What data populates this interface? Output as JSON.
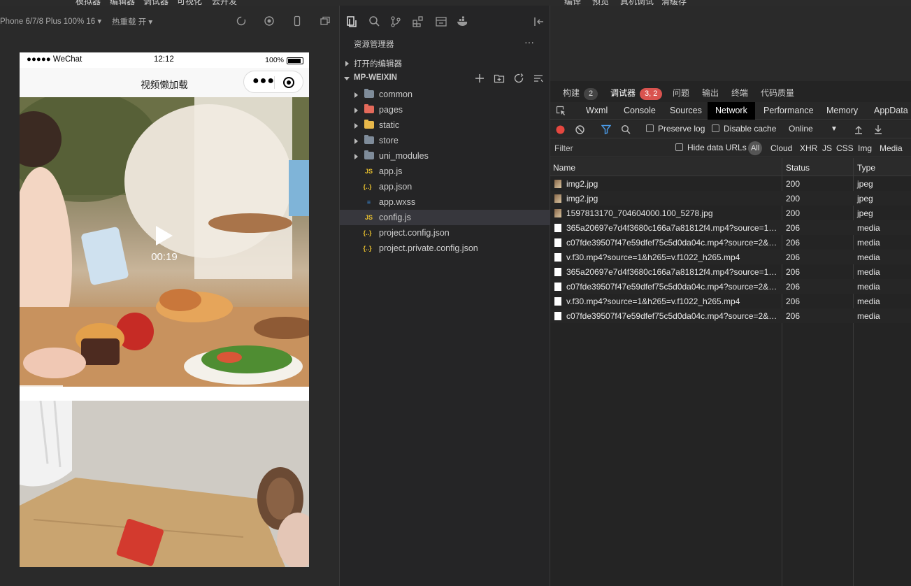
{
  "top_menu": {
    "left_items": [
      "模拟器",
      "编辑器",
      "调试器",
      "可视化",
      "云开发"
    ],
    "right_items": [
      "编译",
      "预览",
      "真机调试",
      "清缓存"
    ]
  },
  "simulator": {
    "device_label": "Phone 6/7/8 Plus 100% 16 ▾",
    "hot_reload_label": "热重载 开 ▾",
    "status_bar": {
      "carrier": "●●●●● WeChat",
      "time": "12:12",
      "battery": "100%"
    },
    "nav_title": "视频懒加载",
    "video1": {
      "duration": "00:19"
    }
  },
  "explorer": {
    "title": "资源管理器",
    "more": "···",
    "open_editors": "打开的编辑器",
    "root": "MP-WEIXIN",
    "folders": [
      {
        "name": "common",
        "color": "#7f8c9a"
      },
      {
        "name": "pages",
        "color": "#e46a5b"
      },
      {
        "name": "static",
        "color": "#e8b84a"
      },
      {
        "name": "store",
        "color": "#7f8c9a"
      },
      {
        "name": "uni_modules",
        "color": "#7f8c9a"
      }
    ],
    "files": [
      {
        "name": "app.js",
        "icon": "JS",
        "icon_color": "#e8c02e"
      },
      {
        "name": "app.json",
        "icon": "{..}",
        "icon_color": "#e8c02e"
      },
      {
        "name": "app.wxss",
        "icon": "≡",
        "icon_color": "#3b8fe0"
      },
      {
        "name": "config.js",
        "icon": "JS",
        "icon_color": "#e8c02e",
        "selected": true
      },
      {
        "name": "project.config.json",
        "icon": "{..}",
        "icon_color": "#e8c02e"
      },
      {
        "name": "project.private.config.json",
        "icon": "{..}",
        "icon_color": "#e8c02e"
      }
    ]
  },
  "devtools": {
    "panel_tabs": [
      {
        "label": "构建",
        "badge": "2"
      },
      {
        "label": "调试器",
        "badge": "3, 2",
        "active": true
      },
      {
        "label": "问题"
      },
      {
        "label": "输出"
      },
      {
        "label": "终端"
      },
      {
        "label": "代码质量"
      }
    ],
    "inner_tabs": [
      "Wxml",
      "Console",
      "Sources",
      "Network",
      "Performance",
      "Memory",
      "AppData"
    ],
    "active_inner_tab": "Network",
    "toolbar": {
      "preserve_log": "Preserve log",
      "disable_cache": "Disable cache",
      "throttle": "Online"
    },
    "filter": {
      "placeholder": "Filter",
      "hide_data_urls": "Hide data URLs",
      "all": "All",
      "types": [
        "Cloud",
        "XHR",
        "JS",
        "CSS",
        "Img",
        "Media"
      ]
    },
    "table": {
      "columns": [
        "Name",
        "Status",
        "Type"
      ],
      "rows": [
        {
          "name": "img2.jpg",
          "status": "200",
          "type": "jpeg",
          "icon": "img"
        },
        {
          "name": "img2.jpg",
          "status": "200",
          "type": "jpeg",
          "icon": "img"
        },
        {
          "name": "1597813170_704604000.100_5278.jpg",
          "status": "200",
          "type": "jpeg",
          "icon": "img"
        },
        {
          "name": "365a20697e7d4f3680c166a7a81812f4.mp4?source=1&...",
          "status": "206",
          "type": "media",
          "icon": "file"
        },
        {
          "name": "c07fde39507f47e59dfef75c5d0da04c.mp4?source=2&h...",
          "status": "206",
          "type": "media",
          "icon": "file"
        },
        {
          "name": "v.f30.mp4?source=1&h265=v.f1022_h265.mp4",
          "status": "206",
          "type": "media",
          "icon": "file"
        },
        {
          "name": "365a20697e7d4f3680c166a7a81812f4.mp4?source=1&...",
          "status": "206",
          "type": "media",
          "icon": "file"
        },
        {
          "name": "c07fde39507f47e59dfef75c5d0da04c.mp4?source=2&h...",
          "status": "206",
          "type": "media",
          "icon": "file"
        },
        {
          "name": "v.f30.mp4?source=1&h265=v.f1022_h265.mp4",
          "status": "206",
          "type": "media",
          "icon": "file"
        },
        {
          "name": "c07fde39507f47e59dfef75c5d0da04c.mp4?source=2&h...",
          "status": "206",
          "type": "media",
          "icon": "file"
        }
      ]
    }
  }
}
